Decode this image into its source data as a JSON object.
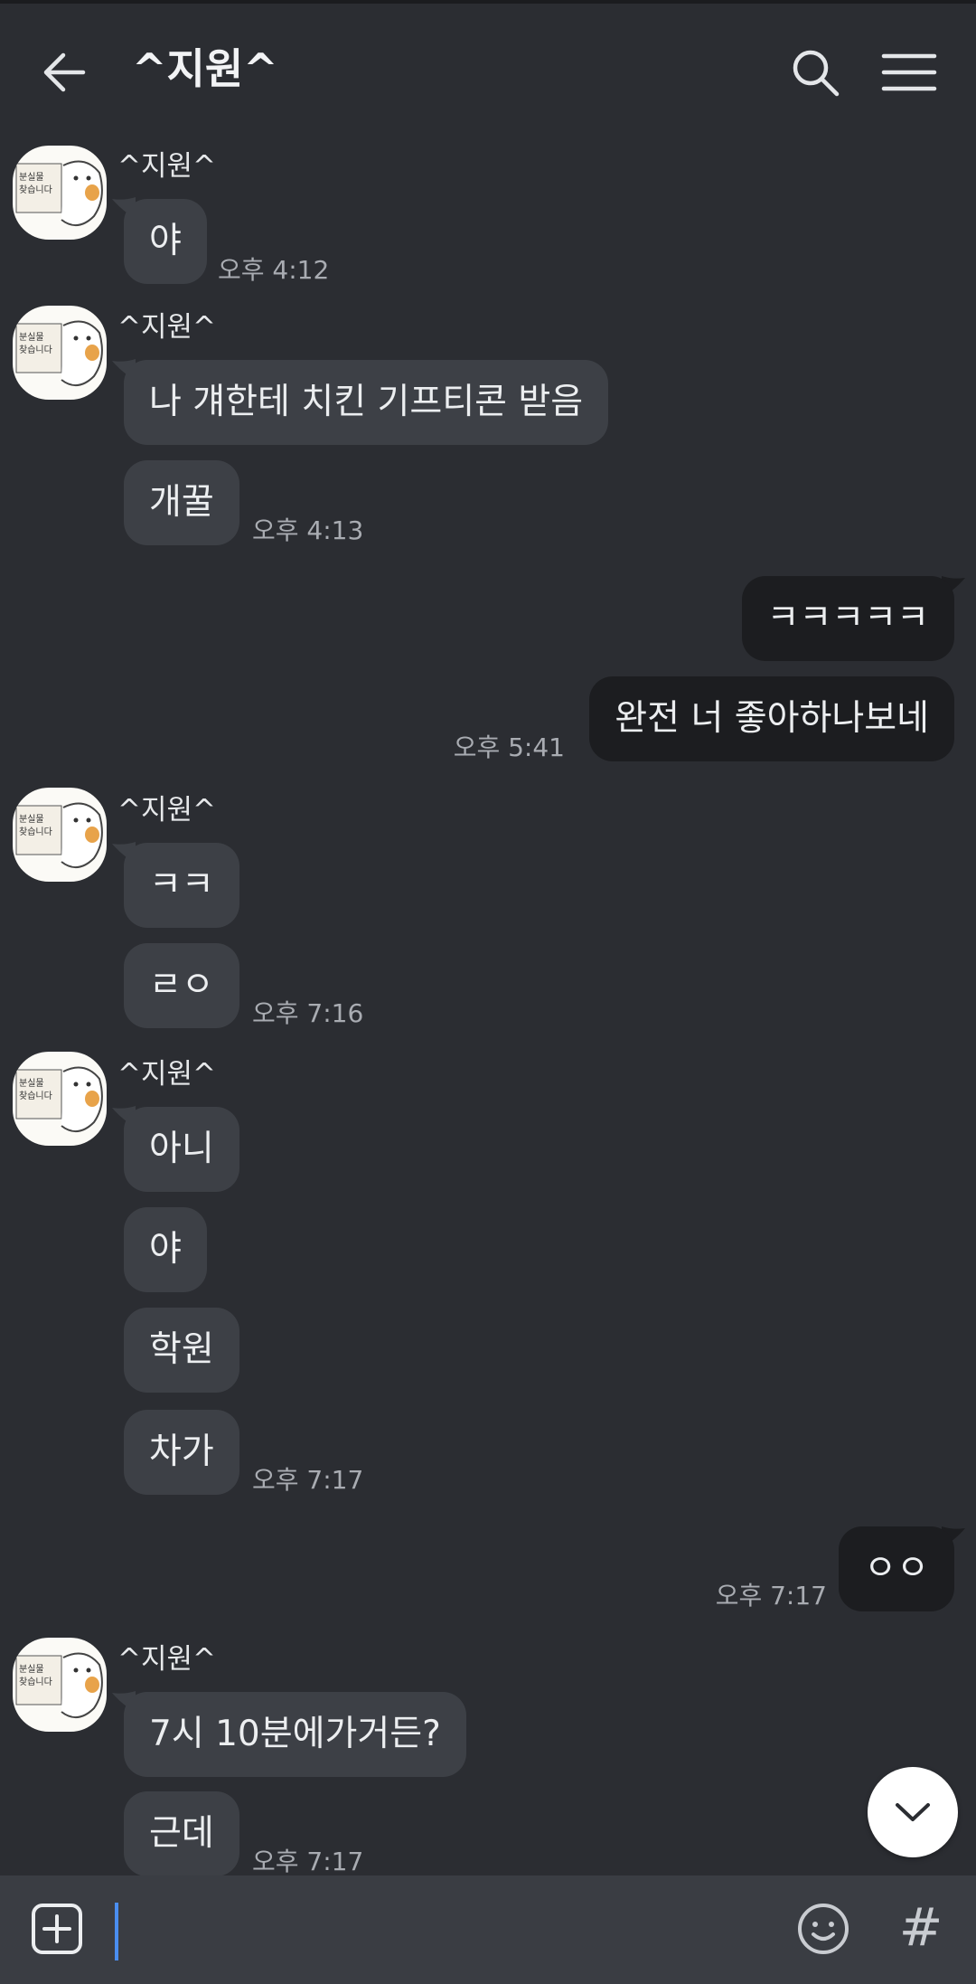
{
  "header": {
    "title": "^지원^"
  },
  "icons": {
    "back": "arrow-left-icon",
    "search": "search-icon",
    "menu": "hamburger-menu-icon",
    "scroll_down": "chevron-down-icon",
    "attach": "plus-square-icon",
    "emoji": "smiley-icon"
  },
  "avatar_text": {
    "line1": "분실물",
    "line2": "찾습니다"
  },
  "messages": [
    {
      "sender": "^지원^",
      "text": "야",
      "time": "오후 4:12"
    },
    {
      "sender": "^지원^",
      "text": "나 걔한테 치킨 기프티콘 받음"
    },
    {
      "text": "개꿀",
      "time": "오후 4:13"
    },
    {
      "text": "ㅋㅋㅋㅋㅋ"
    },
    {
      "text": "완전 너 좋아하나보네",
      "time": "오후 5:41"
    },
    {
      "sender": "^지원^",
      "text": "ㅋㅋ"
    },
    {
      "text": "ㄹㅇ",
      "time": "오후 7:16"
    },
    {
      "sender": "^지원^",
      "text": "아니"
    },
    {
      "text": "야"
    },
    {
      "text": "학원"
    },
    {
      "text": "차가",
      "time": "오후 7:17"
    },
    {
      "text": "ㅇㅇ",
      "time": "오후 7:17"
    },
    {
      "sender": "^지원^",
      "text": "7시 10분에가거든?"
    },
    {
      "text": "근데",
      "time": "오후 7:17"
    }
  ],
  "input": {
    "hash_label": "#"
  },
  "colors": {
    "background": "#2b2d32",
    "incoming_bubble": "#3d4046",
    "outgoing_bubble": "#1c1d20",
    "caret": "#4a8ef0"
  }
}
